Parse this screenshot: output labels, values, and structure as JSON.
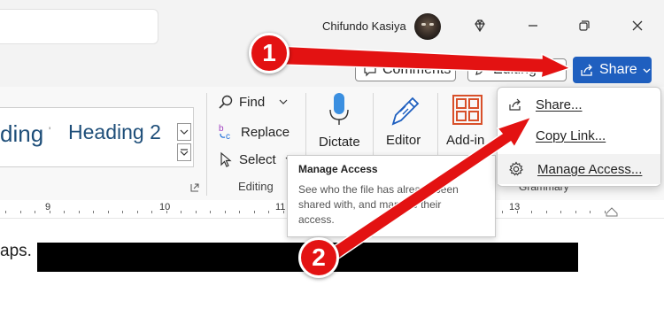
{
  "titlebar": {
    "user_name": "Chifundo Kasiya",
    "icons": [
      "diamond-icon",
      "minimize-icon",
      "restore-icon",
      "close-icon"
    ]
  },
  "commandbar": {
    "comments_label": "Comments",
    "editing_label": "Editing",
    "share_label": "Share"
  },
  "ribbon": {
    "styles": {
      "style_1": "ding",
      "style_1_sep": "'",
      "style_2": "Heading 2"
    },
    "editing_group": {
      "find_label": "Find",
      "replace_label": "Replace",
      "select_label": "Select",
      "group_label": "Editing"
    },
    "dictate_label": "Dictate",
    "editor_label": "Editor",
    "addins_label": "Add-in",
    "grammarly_label": "Grammary"
  },
  "ruler": {
    "numbers": [
      "9",
      "10",
      "11",
      "13"
    ]
  },
  "document": {
    "visible_text": "aps."
  },
  "tooltip": {
    "title": "Manage Access",
    "description": "See who the file has already been shared with, and manage their access."
  },
  "share_menu": {
    "items": [
      {
        "label": "Share...",
        "icon": "share-icon"
      },
      {
        "label": "Copy Link...",
        "icon": "link-icon"
      },
      {
        "label": "Manage Access...",
        "icon": "gear-icon"
      }
    ]
  },
  "annotations": {
    "badge_1": "1",
    "badge_2": "2",
    "color": "#e31212"
  },
  "colors": {
    "accent": "#1f5fbf",
    "heading_text": "#1e4e79",
    "annotation_red": "#e31212"
  }
}
